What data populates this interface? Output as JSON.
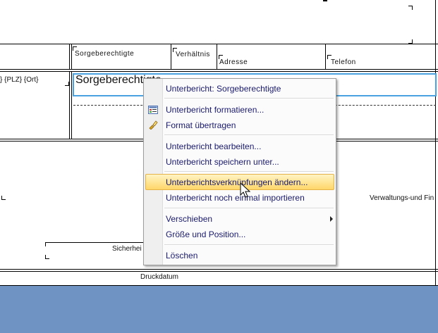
{
  "header_fields": {
    "sorgeberechtigte": "Sorgeberechtigte",
    "verhaeltnis": "Verhältnis",
    "adresse": "Adresse",
    "telefon": "Telefon"
  },
  "detail": {
    "plz_ort": "} {PLZ} {Ort}",
    "subreport_text": "Sorgeberechtigte"
  },
  "lower": {
    "verwaltung": "Verwaltungs-und Fin",
    "sicherheit": "Sicherhei",
    "druckdatum": "Druckdatum"
  },
  "context_menu": {
    "items": [
      {
        "label": "Unterbericht:  Sorgeberechtigte",
        "icon": ""
      },
      {
        "label": "Unterbericht formatieren...",
        "icon": "format-properties-icon"
      },
      {
        "label": "Format übertragen",
        "icon": "format-painter-icon"
      },
      {
        "label": "Unterbericht bearbeiten...",
        "icon": ""
      },
      {
        "label": "Unterbericht speichern unter...",
        "icon": ""
      },
      {
        "label": "Unterberichtsverknüpfungen ändern...",
        "icon": "",
        "highlighted": true
      },
      {
        "label": "Unterbericht noch einmal importieren",
        "icon": ""
      },
      {
        "label": "Verschieben",
        "icon": "",
        "submenu": true
      },
      {
        "label": "Größe und Position...",
        "icon": ""
      },
      {
        "label": "Löschen",
        "icon": ""
      }
    ]
  },
  "colors": {
    "footer_band": "#6f93c3",
    "menu_highlight_border": "#e5b24a",
    "menu_text": "#1a1a6e"
  }
}
